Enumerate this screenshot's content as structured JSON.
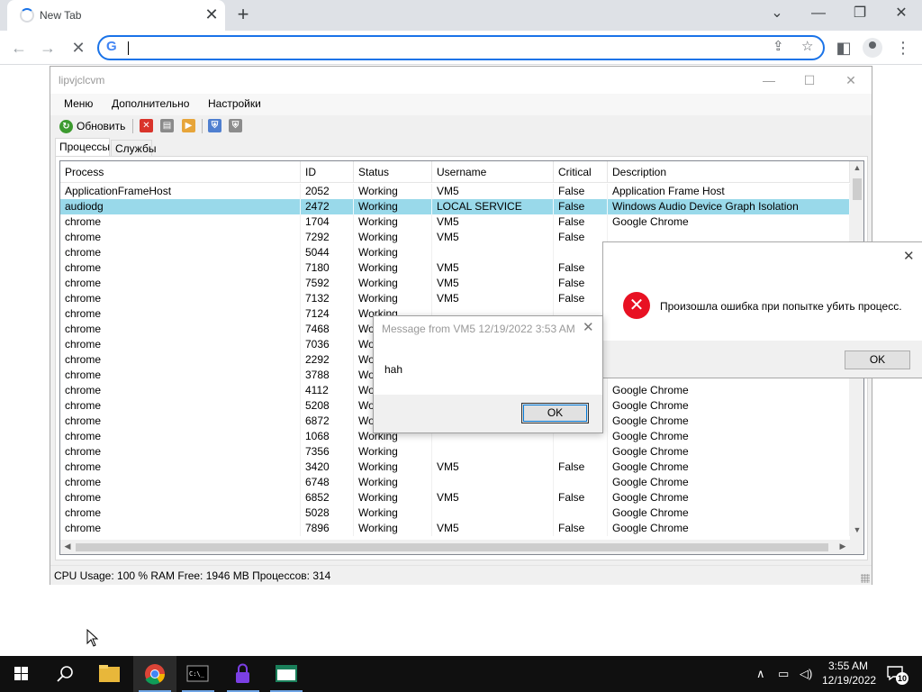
{
  "browser": {
    "tab_title": "New Tab",
    "tab_close": "✕",
    "new_tab": "+",
    "omnibox_value": "",
    "window_controls": [
      "⌄",
      "—",
      "❐",
      "✕"
    ]
  },
  "app": {
    "title": "lipvjclcvm",
    "menu": [
      "Меню",
      "Дополнительно",
      "Настройки"
    ],
    "toolbar": {
      "refresh_label": "Обновить"
    },
    "tabs": [
      "Процессы",
      "Службы"
    ],
    "columns": [
      "Process",
      "ID",
      "Status",
      "Username",
      "Critical",
      "Description"
    ],
    "rows": [
      [
        "ApplicationFrameHost",
        "2052",
        "Working",
        "VM5",
        "False",
        "Application Frame Host"
      ],
      [
        "audiodg",
        "2472",
        "Working",
        "LOCAL SERVICE",
        "False",
        "Windows Audio Device Graph Isolation"
      ],
      [
        "chrome",
        "1704",
        "Working",
        "VM5",
        "False",
        "Google Chrome"
      ],
      [
        "chrome",
        "7292",
        "Working",
        "VM5",
        "False",
        ""
      ],
      [
        "chrome",
        "5044",
        "Working",
        "",
        "",
        ""
      ],
      [
        "chrome",
        "7180",
        "Working",
        "VM5",
        "False",
        ""
      ],
      [
        "chrome",
        "7592",
        "Working",
        "VM5",
        "False",
        ""
      ],
      [
        "chrome",
        "7132",
        "Working",
        "VM5",
        "False",
        ""
      ],
      [
        "chrome",
        "7124",
        "Working",
        "",
        "",
        ""
      ],
      [
        "chrome",
        "7468",
        "Wo",
        "",
        "",
        ""
      ],
      [
        "chrome",
        "7036",
        "Wo",
        "",
        "",
        ""
      ],
      [
        "chrome",
        "2292",
        "Wo",
        "",
        "",
        ""
      ],
      [
        "chrome",
        "3788",
        "Wo",
        "",
        "",
        ""
      ],
      [
        "chrome",
        "4112",
        "Wo",
        "",
        "",
        "Google Chrome"
      ],
      [
        "chrome",
        "5208",
        "Wo",
        "",
        "",
        "Google Chrome"
      ],
      [
        "chrome",
        "6872",
        "Wo",
        "",
        "",
        "Google Chrome"
      ],
      [
        "chrome",
        "1068",
        "Working",
        "",
        "",
        "Google Chrome"
      ],
      [
        "chrome",
        "7356",
        "Working",
        "",
        "",
        "Google Chrome"
      ],
      [
        "chrome",
        "3420",
        "Working",
        "VM5",
        "False",
        "Google Chrome"
      ],
      [
        "chrome",
        "6748",
        "Working",
        "",
        "",
        "Google Chrome"
      ],
      [
        "chrome",
        "6852",
        "Working",
        "VM5",
        "False",
        "Google Chrome"
      ],
      [
        "chrome",
        "5028",
        "Working",
        "",
        "",
        "Google Chrome"
      ],
      [
        "chrome",
        "7896",
        "Working",
        "VM5",
        "False",
        "Google Chrome"
      ]
    ],
    "selected_row": 1,
    "status": "CPU Usage: 100 %  RAM Free: 1946 MB  Процессов: 314"
  },
  "error_dialog": {
    "message": "Произошла ошибка при попытке убить процесс.",
    "ok": "OK"
  },
  "message_dialog": {
    "title": "Message from VM5 12/19/2022 3:53 AM",
    "body": "hah",
    "ok": "OK"
  },
  "taskbar": {
    "time": "3:55 AM",
    "date": "12/19/2022",
    "notification_count": "10"
  }
}
